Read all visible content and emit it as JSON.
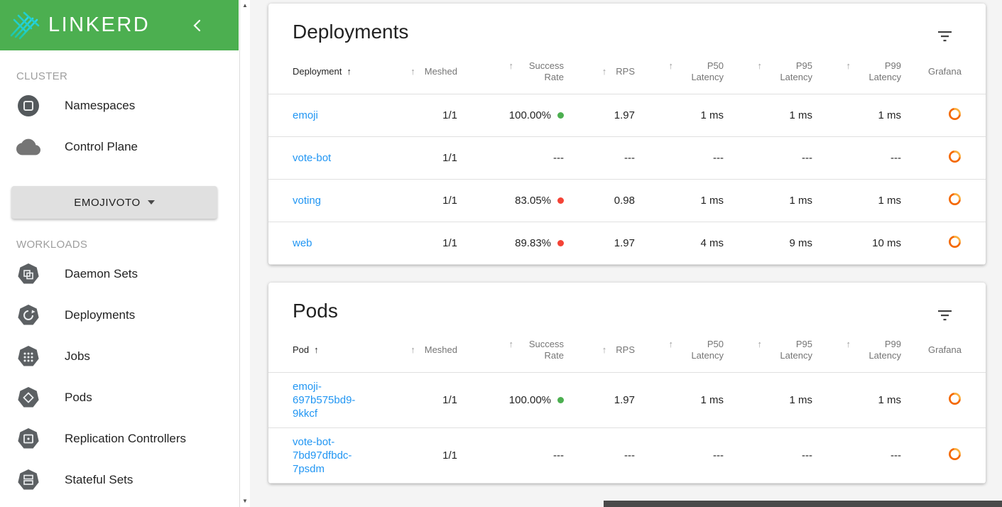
{
  "sidebar": {
    "logo_text": "LINKERD",
    "cluster_label": "CLUSTER",
    "cluster_items": [
      {
        "label": "Namespaces"
      },
      {
        "label": "Control Plane"
      }
    ],
    "namespace_selector": {
      "value": "EMOJIVOTO"
    },
    "workloads_label": "WORKLOADS",
    "workload_items": [
      {
        "label": "Daemon Sets"
      },
      {
        "label": "Deployments"
      },
      {
        "label": "Jobs"
      },
      {
        "label": "Pods"
      },
      {
        "label": "Replication Controllers"
      },
      {
        "label": "Stateful Sets"
      }
    ]
  },
  "deployments_card": {
    "title": "Deployments",
    "columns": [
      "Deployment",
      "Meshed",
      "Success Rate",
      "RPS",
      "P50 Latency",
      "P95 Latency",
      "P99 Latency",
      "Grafana"
    ],
    "rows": [
      {
        "name": "emoji",
        "meshed": "1/1",
        "success_rate": "100.00%",
        "status": "good",
        "rps": "1.97",
        "p50": "1 ms",
        "p95": "1 ms",
        "p99": "1 ms"
      },
      {
        "name": "vote-bot",
        "meshed": "1/1",
        "success_rate": "---",
        "status": "none",
        "rps": "---",
        "p50": "---",
        "p95": "---",
        "p99": "---"
      },
      {
        "name": "voting",
        "meshed": "1/1",
        "success_rate": "83.05%",
        "status": "bad",
        "rps": "0.98",
        "p50": "1 ms",
        "p95": "1 ms",
        "p99": "1 ms"
      },
      {
        "name": "web",
        "meshed": "1/1",
        "success_rate": "89.83%",
        "status": "bad",
        "rps": "1.97",
        "p50": "4 ms",
        "p95": "9 ms",
        "p99": "10 ms"
      }
    ]
  },
  "pods_card": {
    "title": "Pods",
    "columns": [
      "Pod",
      "Meshed",
      "Success Rate",
      "RPS",
      "P50 Latency",
      "P95 Latency",
      "P99 Latency",
      "Grafana"
    ],
    "rows": [
      {
        "name": "emoji-697b575bd9-9kkcf",
        "meshed": "1/1",
        "success_rate": "100.00%",
        "status": "good",
        "rps": "1.97",
        "p50": "1 ms",
        "p95": "1 ms",
        "p99": "1 ms"
      },
      {
        "name": "vote-bot-7bd97dfbdc-7psdm",
        "meshed": "1/1",
        "success_rate": "---",
        "status": "none",
        "rps": "---",
        "p50": "---",
        "p95": "---",
        "p99": "---"
      }
    ]
  },
  "colors": {
    "brand_green": "#4CAF50",
    "link_blue": "#2196F3",
    "success_green": "#4CAF50",
    "failure_red": "#F44336",
    "grafana_orange": "#F46800"
  }
}
